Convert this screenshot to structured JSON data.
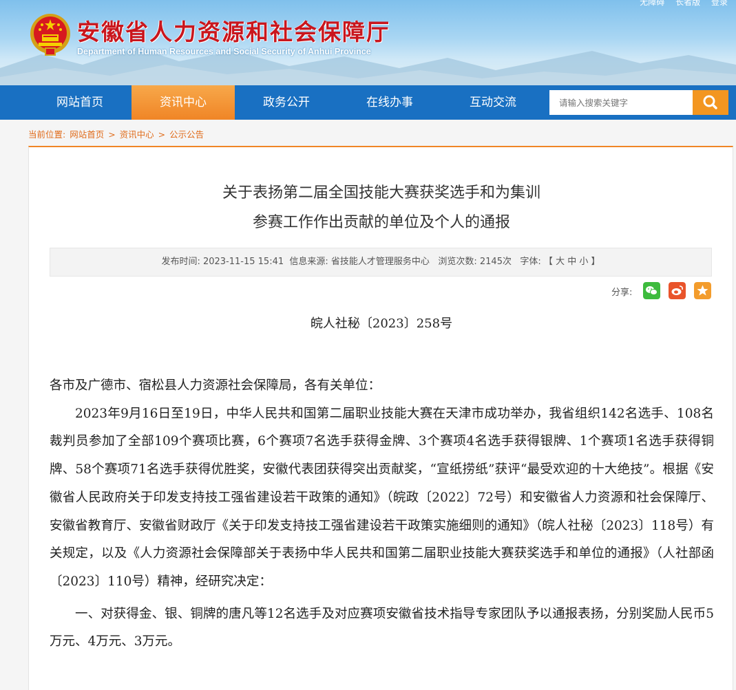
{
  "header": {
    "top_links": [
      "无障碍",
      "长者版",
      "登录"
    ],
    "site_title": "安徽省人力资源和社会保障厅",
    "site_subtitle": "Department of Human Resources and Social Security of Anhui Province"
  },
  "nav": {
    "items": [
      "网站首页",
      "资讯中心",
      "政务公开",
      "在线办事",
      "互动交流"
    ],
    "active": "资讯中心",
    "search_placeholder": "请输入搜索关键字"
  },
  "breadcrumb": {
    "label": "当前位置:",
    "items": [
      "网站首页",
      "资讯中心",
      "公示公告"
    ],
    "separator": ">"
  },
  "article": {
    "title_line1": "关于表扬第二届全国技能大赛获奖选手和为集训",
    "title_line2": "参赛工作作出贡献的单位及个人的通报",
    "meta": {
      "publish_label": "发布时间:",
      "publish_time": "2023-11-15 15:41",
      "source_label": "信息来源:",
      "source": "省技能人才管理服务中心",
      "views_label": "浏览次数:",
      "views": "2145次",
      "font_label": "字体:",
      "font_open": "【",
      "font_large": "大",
      "font_medium": "中",
      "font_small": "小",
      "font_close": "】"
    },
    "share_label": "分享:",
    "share_icons": [
      "wechat-icon",
      "weibo-icon",
      "favorite-icon"
    ],
    "doc_number": "皖人社秘〔2023〕258号",
    "salutation": "各市及广德市、宿松县人力资源社会保障局，各有关单位：",
    "paragraph1": "2023年9月16日至19日，中华人民共和国第二届职业技能大赛在天津市成功举办，我省组织142名选手、108名裁判员参加了全部109个赛项比赛，6个赛项7名选手获得金牌、3个赛项4名选手获得银牌、1个赛项1名选手获得铜牌、58个赛项71名选手获得优胜奖，安徽代表团获得突出贡献奖，“宣纸捞纸”获评“最受欢迎的十大绝技”。根据《安徽省人民政府关于印发支持技工强省建设若干政策的通知》（皖政〔2022〕72号）和安徽省人力资源和社会保障厅、安徽省教育厅、安徽省财政厅《关于印发支持技工强省建设若干政策实施细则的通知》（皖人社秘〔2023〕118号）有关规定，以及《人力资源社会保障部关于表扬中华人民共和国第二届职业技能大赛获奖选手和单位的通报》（人社部函〔2023〕110号）精神，经研究决定：",
    "paragraph2": "一、对获得金、银、铜牌的唐凡等12名选手及对应赛项安徽省技术指导专家团队予以通报表扬，分别奖励人民币5万元、4万元、3万元。"
  },
  "colors": {
    "brand_red": "#c9161d",
    "nav_blue": "#1970c2",
    "accent_orange": "#f08526",
    "wechat_green": "#3dbb3d",
    "weibo_orange": "#e9542b",
    "favorite_orange": "#f39c2c"
  }
}
